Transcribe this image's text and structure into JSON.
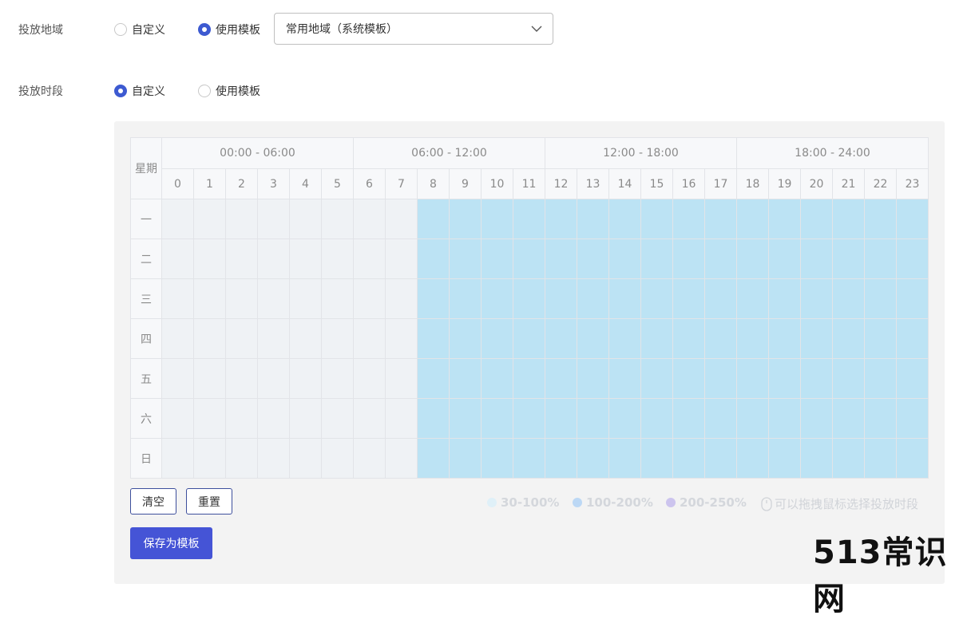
{
  "region": {
    "label": "投放地域",
    "options": [
      {
        "label": "自定义",
        "checked": false
      },
      {
        "label": "使用模板",
        "checked": true
      }
    ],
    "template_select": {
      "value": "常用地域（系统模板）",
      "icon": "chevron-down-icon"
    }
  },
  "schedule": {
    "label": "投放时段",
    "options": [
      {
        "label": "自定义",
        "checked": true
      },
      {
        "label": "使用模板",
        "checked": false
      }
    ]
  },
  "grid": {
    "corner_label": "星期",
    "groups": [
      "00:00 - 06:00",
      "06:00 - 12:00",
      "12:00 - 18:00",
      "18:00 - 24:00"
    ],
    "hours": [
      "0",
      "1",
      "2",
      "3",
      "4",
      "5",
      "6",
      "7",
      "8",
      "9",
      "10",
      "11",
      "12",
      "13",
      "14",
      "15",
      "16",
      "17",
      "18",
      "19",
      "20",
      "21",
      "22",
      "23"
    ],
    "days": [
      "一",
      "二",
      "三",
      "四",
      "五",
      "六",
      "日"
    ],
    "selected_hours": [
      8,
      9,
      10,
      11,
      12,
      13,
      14,
      15,
      16,
      17,
      18,
      19,
      20,
      21,
      22,
      23
    ],
    "selected_color": "#bce3f4",
    "empty_color": "#eff2f5"
  },
  "actions": {
    "clear_label": "清空",
    "reset_label": "重置",
    "save_template_label": "保存为模板"
  },
  "legend": [
    {
      "label": "30-100%",
      "color": "#dff0f8"
    },
    {
      "label": "100-200%",
      "color": "#bcd8f5"
    },
    {
      "label": "200-250%",
      "color": "#ccc4ee"
    }
  ],
  "hint": {
    "icon": "mouse-icon",
    "text": "可以拖拽鼠标选择投放时段"
  },
  "watermark": "513常识网"
}
